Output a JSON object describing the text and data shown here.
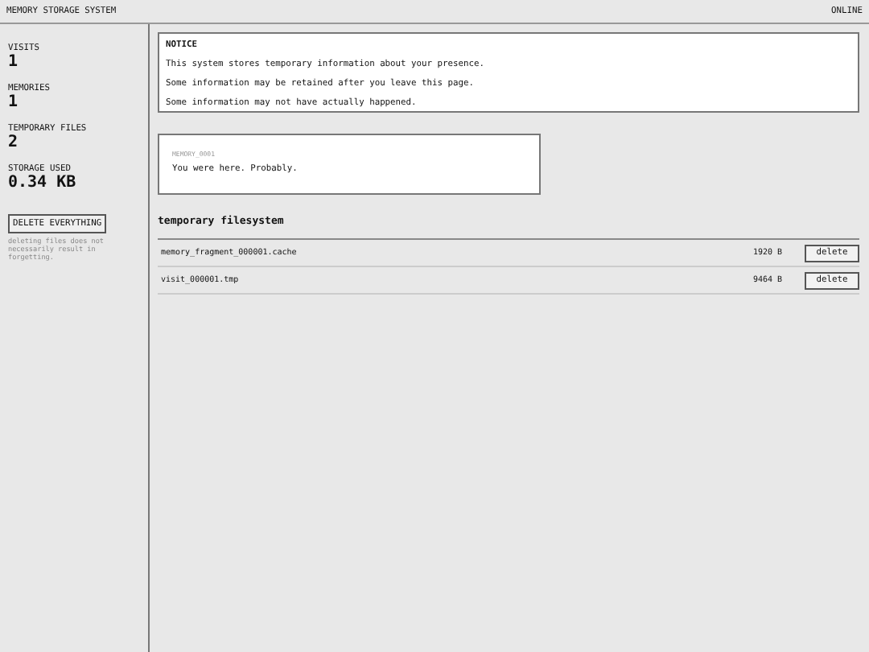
{
  "header": {
    "title": "MEMORY STORAGE SYSTEM",
    "status": "ONLINE"
  },
  "stats": [
    {
      "label": "VISITS",
      "value": "1"
    },
    {
      "label": "MEMORIES",
      "value": "1"
    },
    {
      "label": "TEMPORARY FILES",
      "value": "2"
    },
    {
      "label": "STORAGE USED",
      "value": "0.34 KB"
    }
  ],
  "delete_all": {
    "label": "DELETE EVERYTHING",
    "note": "deleting files does not necessarily result in forgetting."
  },
  "notice": {
    "title": "NOTICE",
    "lines": [
      "This system stores temporary information about your presence.",
      "Some information may be retained after you leave this page.",
      "Some information may not have actually happened."
    ]
  },
  "memories": [
    {
      "id": "MEMORY_0001",
      "text": "You were here. Probably."
    }
  ],
  "filesystem": {
    "title": "temporary filesystem",
    "files": [
      {
        "name": "memory_fragment_000001.cache",
        "size": "1920 B",
        "action": "delete"
      },
      {
        "name": "visit_000001.tmp",
        "size": "9464 B",
        "action": "delete"
      }
    ]
  }
}
